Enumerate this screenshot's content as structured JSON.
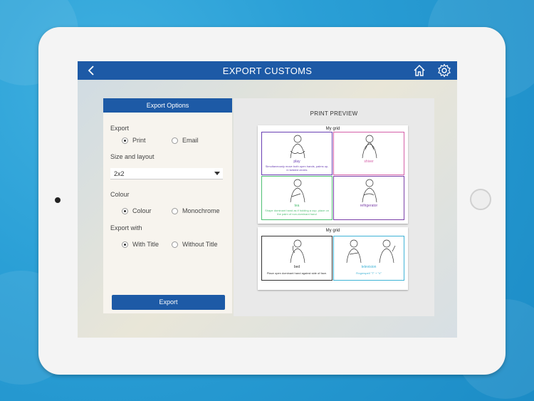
{
  "nav": {
    "title": "EXPORT CUSTOMS"
  },
  "options": {
    "header": "Export Options",
    "export_label": "Export",
    "export_choices": [
      "Print",
      "Email"
    ],
    "size_label": "Size and layout",
    "size_value": "2x2",
    "colour_label": "Colour",
    "colour_choices": [
      "Colour",
      "Monochrome"
    ],
    "exportwith_label": "Export with",
    "exportwith_choices": [
      "With Title",
      "Without Title"
    ],
    "export_button": "Export"
  },
  "preview": {
    "title": "PRINT PREVIEW",
    "page1": {
      "title": "My grid",
      "cells": [
        {
          "word": "play",
          "desc": "Simultaneously move both open hands, palms up, in twisted circles",
          "color": "#6a3fb3"
        },
        {
          "word": "shiver",
          "desc": "",
          "color": "#d45fa8"
        },
        {
          "word": "tea",
          "desc": "Shape dominant hand as if holding a cup, place on the palm of non-dominant hand",
          "color": "#4fbf73"
        },
        {
          "word": "refrigerator",
          "desc": "",
          "color": "#7a3fa8"
        }
      ]
    },
    "page2": {
      "title": "My grid",
      "cells": [
        {
          "word": "bed",
          "desc": "Place open dominant hand against side of face.",
          "color": "#333333"
        },
        {
          "word": "television",
          "desc": "Fingerspell \"T\" + \"V\"",
          "color": "#3fb3d6"
        }
      ]
    }
  }
}
